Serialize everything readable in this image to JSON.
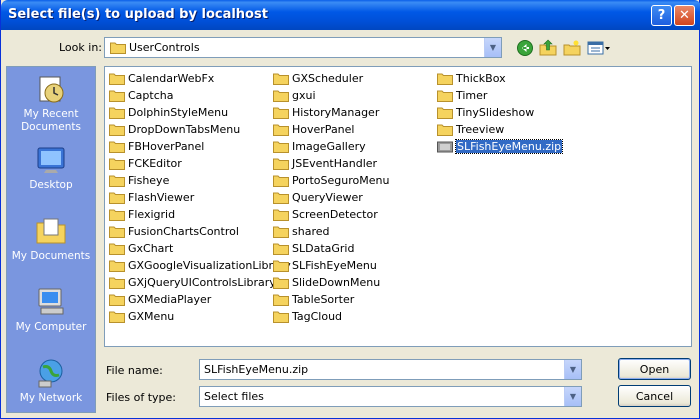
{
  "title": "Select file(s) to upload by localhost",
  "lookin": {
    "label": "Look in:",
    "value": "UserControls"
  },
  "places": [
    "My Recent Documents",
    "Desktop",
    "My Documents",
    "My Computer",
    "My Network"
  ],
  "files": {
    "col1": [
      "CalendarWebFx",
      "Captcha",
      "DolphinStyleMenu",
      "DropDownTabsMenu",
      "FBHoverPanel",
      "FCKEditor",
      "Fisheye",
      "FlashViewer",
      "Flexigrid",
      "FusionChartsControl",
      "GxChart",
      "GXGoogleVisualizationLibrary",
      "GXjQueryUIControlsLibrary",
      "GXMediaPlayer",
      "GXMenu"
    ],
    "col2": [
      "GXScheduler",
      "gxui",
      "HistoryManager",
      "HoverPanel",
      "ImageGallery",
      "JSEventHandler",
      "PortoSeguroMenu",
      "QueryViewer",
      "ScreenDetector",
      "shared",
      "SLDataGrid",
      "SLFishEyeMenu",
      "SlideDownMenu",
      "TableSorter",
      "TagCloud"
    ],
    "col3": [
      "ThickBox",
      "Timer",
      "TinySlideshow",
      "Treeview"
    ],
    "selected_file": "SLFishEyeMenu.zip"
  },
  "filename": {
    "label": "File name:",
    "value": "SLFishEyeMenu.zip"
  },
  "filetype": {
    "label": "Files of type:",
    "value": "Select files"
  },
  "buttons": {
    "open": "Open",
    "cancel": "Cancel"
  },
  "colors": {
    "titlebar": "#0054e3",
    "places": "#7a96df",
    "selection": "#316ac5",
    "folder": "#f5d35e"
  }
}
